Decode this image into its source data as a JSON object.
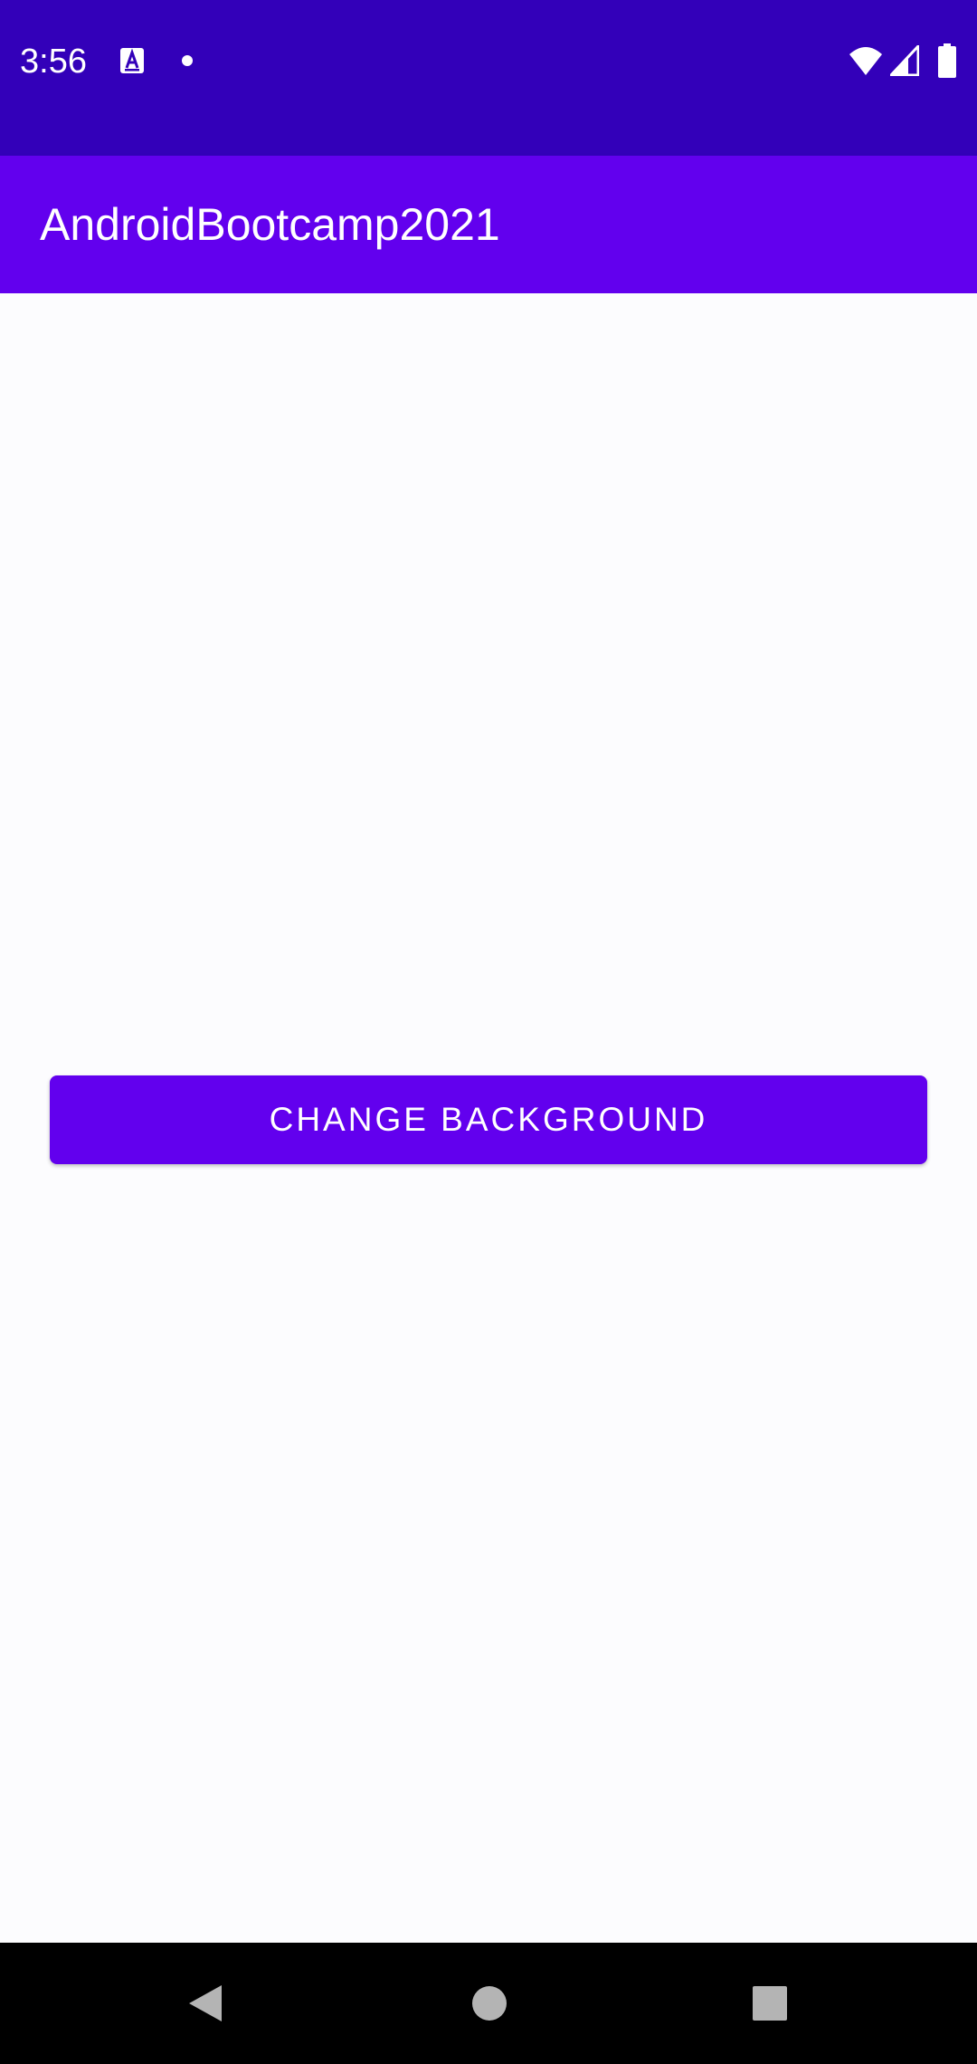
{
  "status_bar": {
    "time": "3:56",
    "icons": [
      "notification-a-icon",
      "notification-dot-icon",
      "wifi-icon",
      "cellular-signal-icon",
      "battery-icon"
    ]
  },
  "app_bar": {
    "title": "AndroidBootcamp2021"
  },
  "main": {
    "change_background_button_label": "CHANGE BACKGROUND"
  },
  "nav_bar": {
    "buttons": [
      "back-icon",
      "home-icon",
      "recents-icon"
    ]
  },
  "colors": {
    "status_bar": "#3300b9",
    "app_bar": "#6200ee",
    "button": "#6200ee",
    "background": "#fcfcfe",
    "nav_bar": "#000000"
  }
}
